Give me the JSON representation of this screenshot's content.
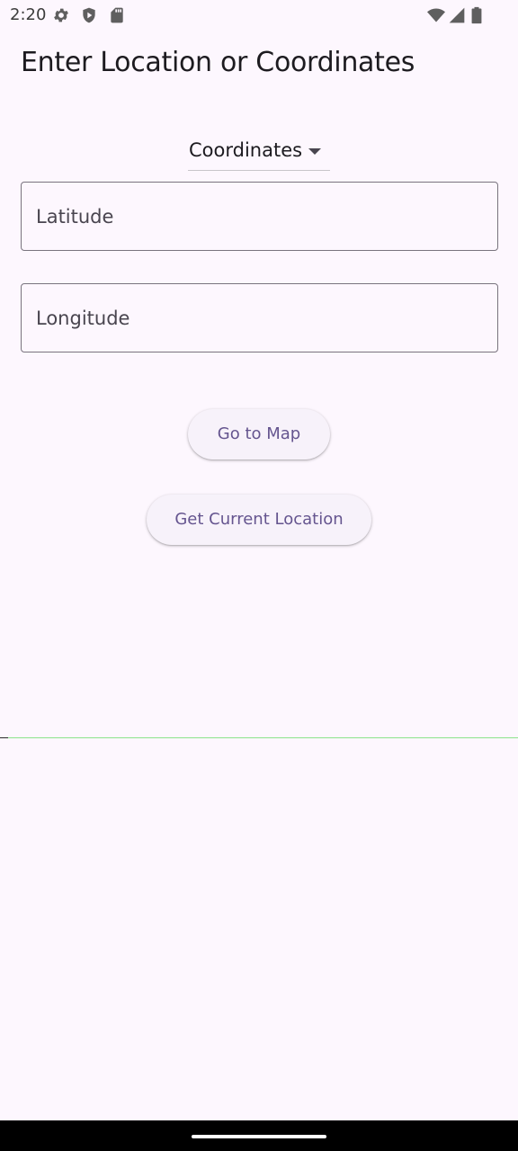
{
  "status_bar": {
    "time": "2:20",
    "icons": [
      "gear-icon",
      "shield-icon",
      "sd-card-icon",
      "wifi-icon",
      "cell-signal-icon",
      "battery-icon"
    ]
  },
  "header": {
    "title": "Enter Location or Coordinates"
  },
  "mode_selector": {
    "selected": "Coordinates"
  },
  "fields": {
    "latitude": {
      "placeholder": "Latitude",
      "value": ""
    },
    "longitude": {
      "placeholder": "Longitude",
      "value": ""
    }
  },
  "actions": {
    "go_to_map": "Go to Map",
    "get_current_location": "Get Current Location"
  },
  "colors": {
    "background": "#fdf7fe",
    "button_text": "#65558f",
    "button_bg": "#f7f2fa",
    "field_border": "#79747e",
    "divider": "#8be38b"
  }
}
